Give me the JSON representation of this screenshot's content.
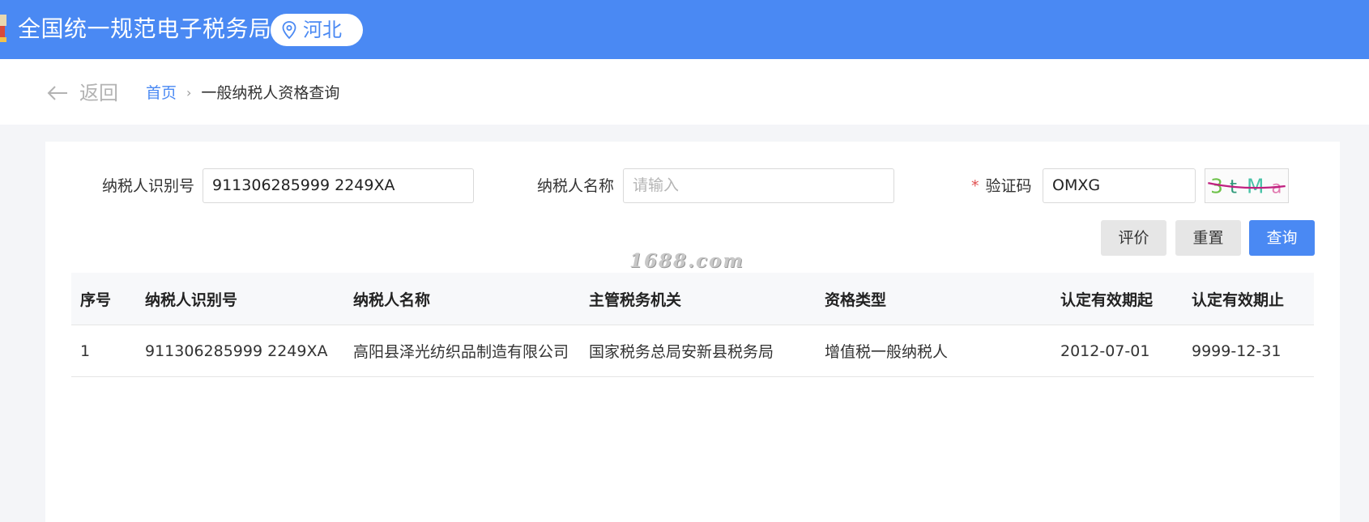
{
  "header": {
    "title": "全国统一规范电子税务局",
    "region": "河北",
    "brand_color": "#4a89f3"
  },
  "nav": {
    "back_label": "返回",
    "breadcrumb_home": "首页",
    "breadcrumb_separator": "›",
    "breadcrumb_current": "一般纳税人资格查询"
  },
  "form": {
    "taxpayer_id_label": "纳税人识别号",
    "taxpayer_id_value": "911306285999 2249XA",
    "taxpayer_name_label": "纳税人名称",
    "taxpayer_name_placeholder": "请输入",
    "captcha_required_mark": "*",
    "captcha_label": "验证码",
    "captcha_value": "OMXG",
    "captcha_image_text": "3tMa"
  },
  "buttons": {
    "evaluate": "评价",
    "reset": "重置",
    "query": "查询"
  },
  "watermark": "1688.com",
  "table": {
    "columns": [
      "序号",
      "纳税人识别号",
      "纳税人名称",
      "主管税务机关",
      "资格类型",
      "认定有效期起",
      "认定有效期止"
    ],
    "rows": [
      [
        "1",
        "911306285999 2249XA",
        "高阳县泽光纺织品制造有限公司",
        "国家税务总局安新县税务局",
        "增值税一般纳税人",
        "2012-07-01",
        "9999-12-31"
      ]
    ]
  }
}
